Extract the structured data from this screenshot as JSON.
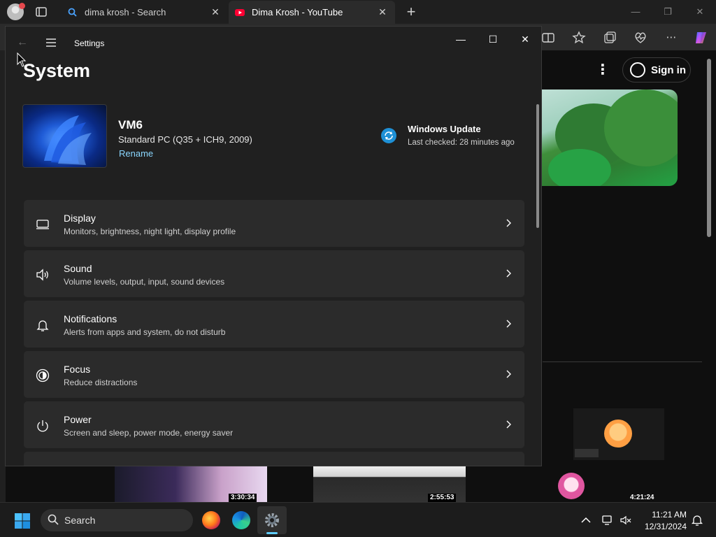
{
  "browser": {
    "tabs": [
      {
        "title": "dima krosh - Search",
        "active": false
      },
      {
        "title": "Dima Krosh - YouTube",
        "active": true
      }
    ],
    "new_tab_icon": "plus-icon"
  },
  "youtube": {
    "sign_in_label": "Sign in",
    "durations": [
      "3:30:34",
      "2:55:53",
      "4:21:24"
    ]
  },
  "settings": {
    "window_title": "Settings",
    "page_title": "System",
    "device": {
      "name": "VM6",
      "model": "Standard PC (Q35 + ICH9, 2009)",
      "rename_label": "Rename"
    },
    "windows_update": {
      "title": "Windows Update",
      "status": "Last checked: 28 minutes ago"
    },
    "items": [
      {
        "label": "Display",
        "desc": "Monitors, brightness, night light, display profile",
        "icon": "monitor-icon"
      },
      {
        "label": "Sound",
        "desc": "Volume levels, output, input, sound devices",
        "icon": "speaker-icon"
      },
      {
        "label": "Notifications",
        "desc": "Alerts from apps and system, do not disturb",
        "icon": "bell-icon"
      },
      {
        "label": "Focus",
        "desc": "Reduce distractions",
        "icon": "focus-icon"
      },
      {
        "label": "Power",
        "desc": "Screen and sleep, power mode, energy saver",
        "icon": "power-icon"
      }
    ]
  },
  "taskbar": {
    "search_label": "Search",
    "time": "11:21 AM",
    "date": "12/31/2024"
  },
  "colors": {
    "accent": "#60cdff",
    "link": "#8ad6ff",
    "card": "#2b2b2b",
    "window_bg": "#202020"
  }
}
